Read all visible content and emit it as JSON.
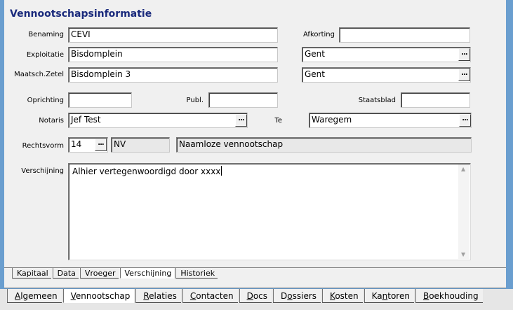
{
  "title": "Vennootschapsinformatie",
  "labels": {
    "benaming": "Benaming",
    "afkorting": "Afkorting",
    "exploitatie": "Exploitatie",
    "zetel": "Maatsch.Zetel",
    "oprichting": "Oprichting",
    "publ": "Publ.",
    "staatsblad": "Staatsblad",
    "notaris": "Notaris",
    "te": "Te",
    "rechtsvorm": "Rechtsvorm",
    "verschijning": "Verschijning"
  },
  "values": {
    "benaming": "CEVI",
    "afkorting": "",
    "exploitatie": "Bisdomplein",
    "exploitatie_stad": "Gent",
    "zetel": "Bisdomplein 3",
    "zetel_stad": "Gent",
    "oprichting": "",
    "publ": "",
    "staatsblad": "",
    "notaris": "Jef Test",
    "te": "Waregem",
    "rechtsvorm_code": "14",
    "rechtsvorm_afk": "NV",
    "rechtsvorm_naam": "Naamloze vennootschap",
    "verschijning": "Alhier vertegenwoordigd door xxxx"
  },
  "ellipsis": "...",
  "subtabs": [
    "Kapitaal",
    "Data",
    "Vroeger",
    "Verschijning",
    "Historiek"
  ],
  "subtabs_active": 3,
  "maintabs": [
    {
      "pre": "",
      "u": "A",
      "post": "lgemeen"
    },
    {
      "pre": "",
      "u": "V",
      "post": "ennootschap"
    },
    {
      "pre": "",
      "u": "R",
      "post": "elaties"
    },
    {
      "pre": "",
      "u": "C",
      "post": "ontacten"
    },
    {
      "pre": "",
      "u": "D",
      "post": "ocs"
    },
    {
      "pre": "D",
      "u": "o",
      "post": "ssiers"
    },
    {
      "pre": "",
      "u": "K",
      "post": "osten"
    },
    {
      "pre": "Ka",
      "u": "n",
      "post": "toren"
    },
    {
      "pre": "",
      "u": "B",
      "post": "oekhouding"
    }
  ],
  "maintabs_active": 1
}
